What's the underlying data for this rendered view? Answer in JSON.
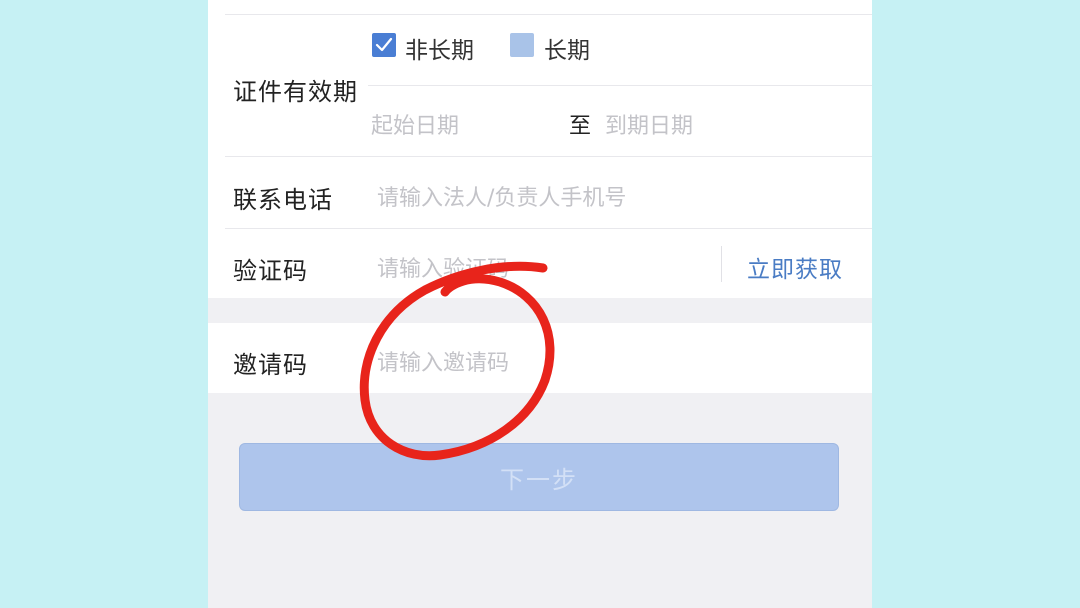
{
  "form": {
    "validity": {
      "label": "证件有效期",
      "option_non_long_term": "非长期",
      "option_long_term": "长期",
      "start_placeholder": "起始日期",
      "to": "至",
      "end_placeholder": "到期日期"
    },
    "phone": {
      "label": "联系电话",
      "placeholder": "请输入法人/负责人手机号"
    },
    "code": {
      "label": "验证码",
      "placeholder": "请输入验证码",
      "get_code": "立即获取"
    },
    "invite": {
      "label": "邀请码",
      "placeholder": "请输入邀请码"
    },
    "next_label": "下一步"
  },
  "colors": {
    "background": "#c6f1f4",
    "accent": "#4a7ed4",
    "annotation": "#e8241b",
    "button": "#aec5ec"
  }
}
